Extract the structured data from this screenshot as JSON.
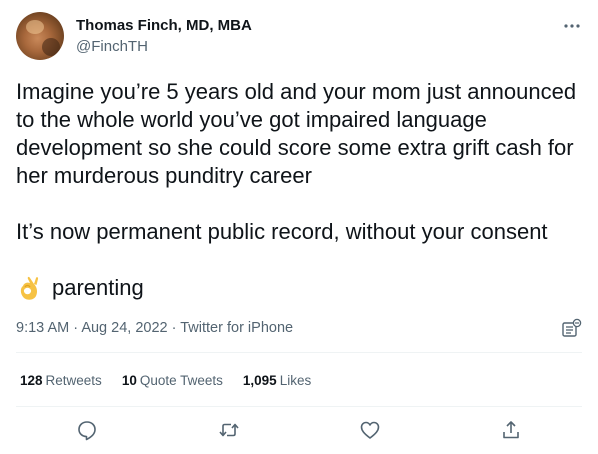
{
  "author": {
    "name": "Thomas Finch, MD, MBA",
    "handle": "@FinchTH"
  },
  "tweet": {
    "paragraphs": [
      "Imagine you’re 5 years old and your mom just announced to the whole world you’ve got impaired language development so she could score some extra grift cash for her murderous punditry career",
      "It’s now permanent public record, without your consent"
    ],
    "reaction_text": "parenting",
    "reaction_icon": "ok-hand-icon"
  },
  "meta": {
    "time": "9:13 AM",
    "separator": "·",
    "date": "Aug 24, 2022",
    "source": "Twitter for iPhone"
  },
  "stats": {
    "retweets_count": "128",
    "retweets_label": "Retweets",
    "quotes_count": "10",
    "quotes_label": "Quote Tweets",
    "likes_count": "1,095",
    "likes_label": "Likes"
  },
  "colors": {
    "text": "#0f1419",
    "secondary": "#536471",
    "divider": "#eff3f4",
    "emoji": "#f6c244"
  },
  "icons": [
    "more-icon",
    "analytics-icon",
    "reply-icon",
    "retweet-icon",
    "like-icon",
    "share-icon"
  ]
}
